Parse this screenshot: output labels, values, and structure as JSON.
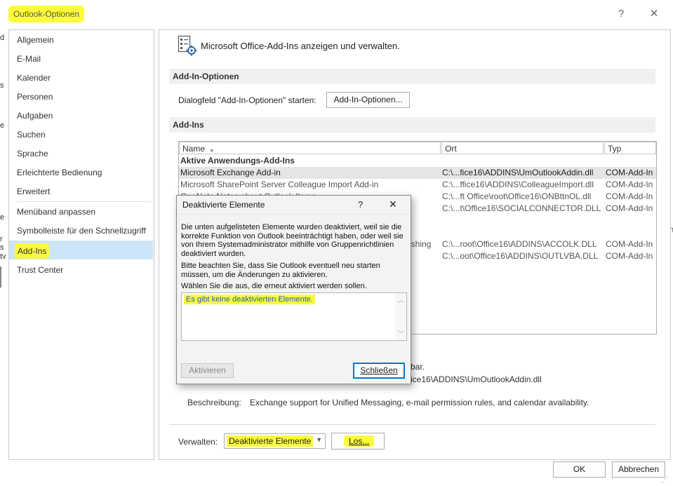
{
  "window": {
    "title": "Outlook-Optionen",
    "help_glyph": "?",
    "close_glyph": "✕"
  },
  "nav": {
    "items": [
      {
        "label": "Allgemein"
      },
      {
        "label": "E-Mail"
      },
      {
        "label": "Kalender"
      },
      {
        "label": "Personen"
      },
      {
        "label": "Aufgaben"
      },
      {
        "label": "Suchen"
      },
      {
        "label": "Sprache"
      },
      {
        "label": "Erleichterte Bedienung"
      },
      {
        "label": "Erweitert"
      },
      {
        "label": "Menüband anpassen"
      },
      {
        "label": "Symbolleiste für den Schnellzugriff"
      },
      {
        "label": "Add-Ins"
      },
      {
        "label": "Trust Center"
      }
    ],
    "selected": "Add-Ins"
  },
  "main": {
    "header_text": "Microsoft Office-Add-Ins anzeigen und verwalten.",
    "addin_options": {
      "section_title": "Add-In-Optionen",
      "label": "Dialogfeld \"Add-In-Optionen\" starten:",
      "button": "Add-In-Optionen..."
    },
    "addins": {
      "section_title": "Add-Ins",
      "columns": [
        "Name",
        "Ort",
        "Typ"
      ],
      "group_active": "Aktive Anwendungs-Add-Ins",
      "rows": [
        {
          "name": "Microsoft Exchange Add-in",
          "location": "C:\\...fice16\\ADDINS\\UmOutlookAddin.dll",
          "type": "COM-Add-In"
        },
        {
          "name": "Microsoft SharePoint Server Colleague Import Add-in",
          "location": "C:\\...ffice16\\ADDINS\\ColleagueImport.dll",
          "type": "COM-Add-In"
        },
        {
          "name": "OneNote Notes about Outlook Items",
          "location": "C:\\...ft Office\\root\\Office16\\ONBttnOL.dll",
          "type": "COM-Add-In"
        },
        {
          "name": "",
          "location": "C:\\...t\\Office16\\SOCIALCONNECTOR.DLL",
          "type": "COM-Add-In"
        },
        {
          "name": "ishing",
          "location": "C:\\...root\\Office16\\ADDINS\\ACCOLK.DLL",
          "type": "COM-Add-In"
        },
        {
          "name": "",
          "location": "C:\\...oot\\Office16\\ADDINS\\OUTLVBA.DLL",
          "type": "COM-Add-In"
        }
      ]
    },
    "details": {
      "partial_compat": "bar.",
      "partial_path": "ice16\\ADDINS\\UmOutlookAddin.dll",
      "description_label": "Beschreibung:",
      "description": "Exchange support for Unified Messaging, e-mail permission rules, and calendar availability."
    },
    "manage": {
      "label": "Verwalten:",
      "selected": "Deaktivierte Elemente",
      "go_button": "Los..."
    }
  },
  "footer": {
    "ok": "OK",
    "cancel": "Abbrechen"
  },
  "dialog": {
    "title": "Deaktivierte Elemente",
    "help_glyph": "?",
    "close_glyph": "✕",
    "text1": "Die unten aufgelisteten Elemente wurden deaktiviert, weil sie die korrekte Funktion von Outlook beeinträchtigt haben, oder weil sie von Ihrem Systemadministrator mithilfe von Gruppenrichtlinien deaktiviert wurden.",
    "text2": "Bitte beachten Sie, dass Sie Outlook eventuell neu starten müssen, um die Änderungen zu aktivieren.",
    "text3": "Wählen Sie die aus, die erneut aktiviert werden sollen.",
    "empty_message": "Es gibt keine deaktivierten Elemente.",
    "activate_button": "Aktivieren",
    "close_button": "Schließen"
  },
  "colors": {
    "highlight": "#fbfb3c",
    "nav_selected": "#cce4f7",
    "accent": "#0078d7"
  }
}
